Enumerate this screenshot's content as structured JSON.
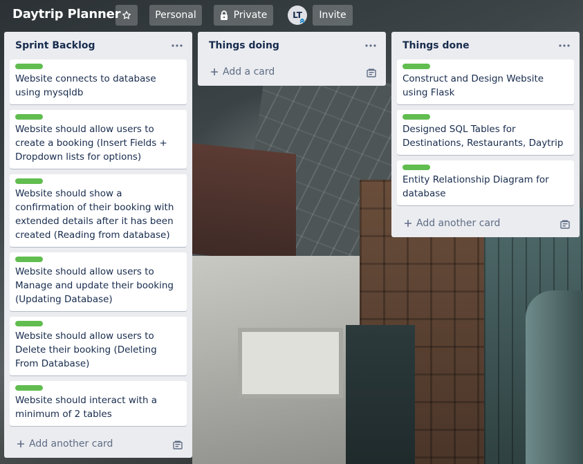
{
  "board": {
    "title": "Daytrip Planner",
    "personal_label": "Personal",
    "private_label": "Private",
    "avatar_initials": "LT",
    "invite_label": "Invite"
  },
  "lists": [
    {
      "title": "Sprint Backlog",
      "cards": [
        {
          "text": "Website connects to database using mysqldb",
          "label_color": "#61bd4f"
        },
        {
          "text": "Website should allow users to create a booking (Insert Fields + Dropdown lists for options)",
          "label_color": "#61bd4f"
        },
        {
          "text": "Website should show a confirmation of their booking with extended details after it has been created (Reading from database)",
          "label_color": "#61bd4f"
        },
        {
          "text": "Website should allow users to Manage and update their booking (Updating Database)",
          "label_color": "#61bd4f"
        },
        {
          "text": "Website should allow users to Delete their booking (Deleting From Database)",
          "label_color": "#61bd4f"
        },
        {
          "text": "Website should interact with a minimum of 2 tables",
          "label_color": "#61bd4f"
        }
      ],
      "add_label": "Add another card"
    },
    {
      "title": "Things doing",
      "cards": [],
      "add_label": "Add a card"
    },
    {
      "title": "Things done",
      "cards": [
        {
          "text": "Construct and Design Website using Flask",
          "label_color": "#61bd4f"
        },
        {
          "text": "Designed SQL Tables for Destinations, Restaurants, Daytrip",
          "label_color": "#61bd4f"
        },
        {
          "text": "Entity Relationship Diagram for database",
          "label_color": "#61bd4f"
        }
      ],
      "add_label": "Add another card"
    }
  ],
  "icons": {
    "star": "star-icon",
    "lock": "lock-icon",
    "menu": "ellipsis-icon",
    "plus": "plus-icon",
    "template": "card-template-icon",
    "admin": "admin-chevron-icon"
  },
  "colors": {
    "list_bg": "#ebecf0",
    "label_green": "#61bd4f",
    "text": "#172b4d",
    "muted": "#5e6c84"
  }
}
